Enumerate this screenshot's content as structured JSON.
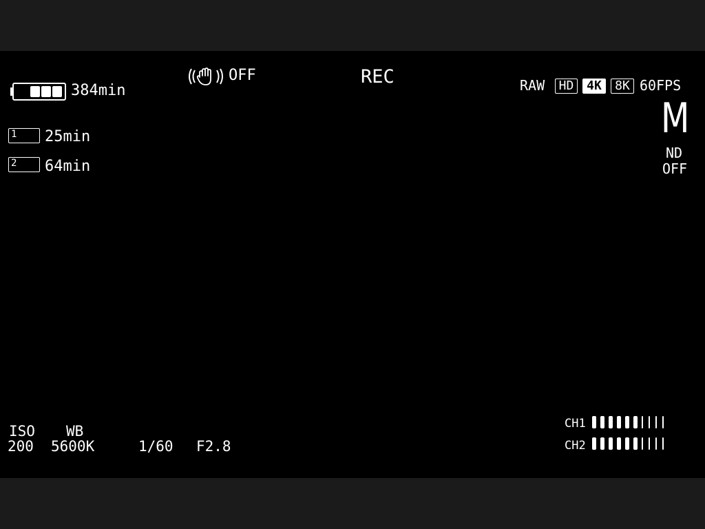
{
  "header": {
    "battery_time": "384min",
    "stabilizer_state": "OFF",
    "rec_label": "REC"
  },
  "battery": {
    "level_bars": 3,
    "total_bars": 3
  },
  "media_slots": [
    {
      "slot": "1",
      "time": "25min"
    },
    {
      "slot": "2",
      "time": "64min"
    }
  ],
  "format": {
    "codec": "RAW",
    "res_hd": "HD",
    "res_4k": "4K",
    "res_8k": "8K",
    "fps": "60FPS",
    "selected_resolution": "4K"
  },
  "mode": {
    "exposure_mode": "M",
    "nd_label": "ND",
    "nd_state": "OFF"
  },
  "exposure": {
    "iso_label": "ISO",
    "iso_value": "200",
    "wb_label": "WB",
    "wb_value": "5600K",
    "shutter": "1/60",
    "aperture": "F2.8"
  },
  "audio": {
    "channels": [
      {
        "label": "CH1",
        "level": 6,
        "segments": 10
      },
      {
        "label": "CH2",
        "level": 6,
        "segments": 10
      }
    ]
  },
  "icons": {
    "stabilizer": "hand-stabilizer-icon",
    "battery": "battery-icon",
    "media": "sd-card-icon"
  }
}
